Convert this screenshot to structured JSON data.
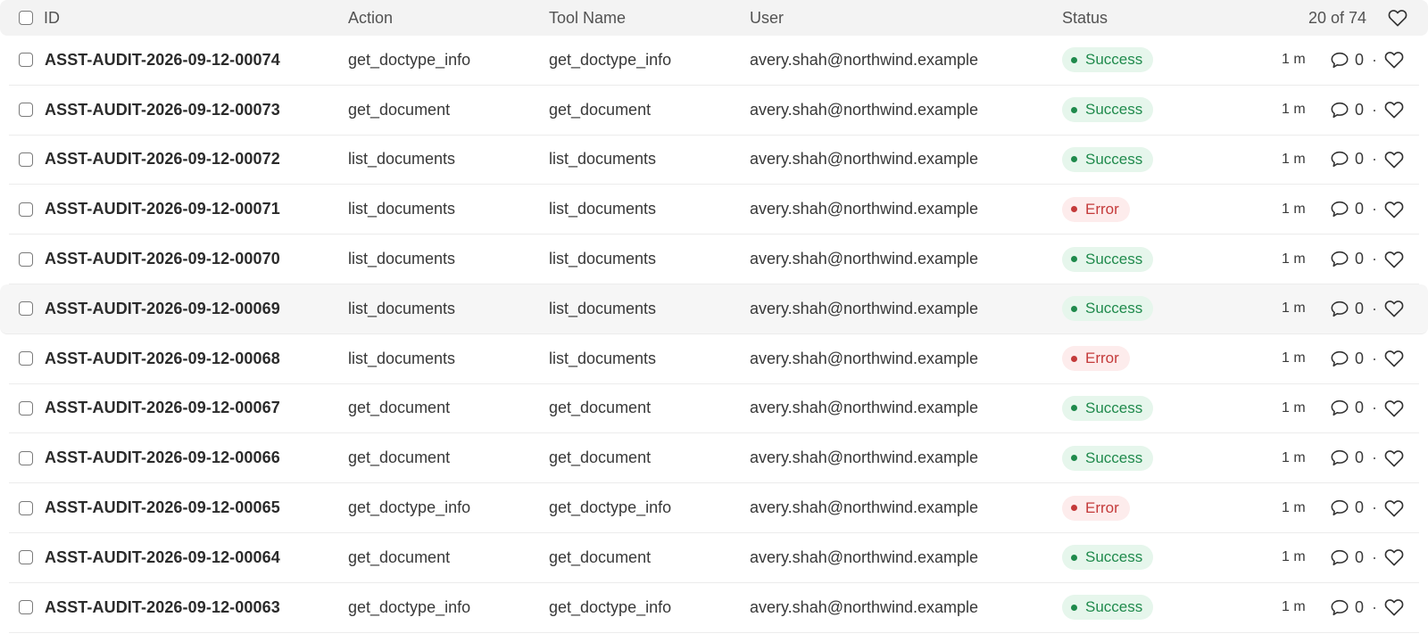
{
  "header": {
    "id_label": "ID",
    "action_label": "Action",
    "tool_label": "Tool Name",
    "user_label": "User",
    "status_label": "Status",
    "count_label": "20 of 74"
  },
  "icons": {
    "comment": "comment-icon",
    "like": "heart-icon",
    "checkbox": "checkbox"
  },
  "colors": {
    "success": "#1f8a4c",
    "success_bg": "#e6f6ec",
    "error": "#c43a3a",
    "error_bg": "#fdecec"
  },
  "rows": [
    {
      "id": "ASST-AUDIT-2026-09-12-00074",
      "action": "get_doctype_info",
      "tool": "get_doctype_info",
      "user": "avery.shah@northwind.example",
      "status": "Success",
      "status_kind": "success",
      "time": "1 m",
      "comments": "0",
      "sep": "·"
    },
    {
      "id": "ASST-AUDIT-2026-09-12-00073",
      "action": "get_document",
      "tool": "get_document",
      "user": "avery.shah@northwind.example",
      "status": "Success",
      "status_kind": "success",
      "time": "1 m",
      "comments": "0",
      "sep": "·"
    },
    {
      "id": "ASST-AUDIT-2026-09-12-00072",
      "action": "list_documents",
      "tool": "list_documents",
      "user": "avery.shah@northwind.example",
      "status": "Success",
      "status_kind": "success",
      "time": "1 m",
      "comments": "0",
      "sep": "·"
    },
    {
      "id": "ASST-AUDIT-2026-09-12-00071",
      "action": "list_documents",
      "tool": "list_documents",
      "user": "avery.shah@northwind.example",
      "status": "Error",
      "status_kind": "error",
      "time": "1 m",
      "comments": "0",
      "sep": "·"
    },
    {
      "id": "ASST-AUDIT-2026-09-12-00070",
      "action": "list_documents",
      "tool": "list_documents",
      "user": "avery.shah@northwind.example",
      "status": "Success",
      "status_kind": "success",
      "time": "1 m",
      "comments": "0",
      "sep": "·"
    },
    {
      "id": "ASST-AUDIT-2026-09-12-00069",
      "action": "list_documents",
      "tool": "list_documents",
      "user": "avery.shah@northwind.example",
      "status": "Success",
      "status_kind": "success",
      "time": "1 m",
      "comments": "0",
      "sep": "·",
      "hovered": true
    },
    {
      "id": "ASST-AUDIT-2026-09-12-00068",
      "action": "list_documents",
      "tool": "list_documents",
      "user": "avery.shah@northwind.example",
      "status": "Error",
      "status_kind": "error",
      "time": "1 m",
      "comments": "0",
      "sep": "·"
    },
    {
      "id": "ASST-AUDIT-2026-09-12-00067",
      "action": "get_document",
      "tool": "get_document",
      "user": "avery.shah@northwind.example",
      "status": "Success",
      "status_kind": "success",
      "time": "1 m",
      "comments": "0",
      "sep": "·"
    },
    {
      "id": "ASST-AUDIT-2026-09-12-00066",
      "action": "get_document",
      "tool": "get_document",
      "user": "avery.shah@northwind.example",
      "status": "Success",
      "status_kind": "success",
      "time": "1 m",
      "comments": "0",
      "sep": "·"
    },
    {
      "id": "ASST-AUDIT-2026-09-12-00065",
      "action": "get_doctype_info",
      "tool": "get_doctype_info",
      "user": "avery.shah@northwind.example",
      "status": "Error",
      "status_kind": "error",
      "time": "1 m",
      "comments": "0",
      "sep": "·"
    },
    {
      "id": "ASST-AUDIT-2026-09-12-00064",
      "action": "get_document",
      "tool": "get_document",
      "user": "avery.shah@northwind.example",
      "status": "Success",
      "status_kind": "success",
      "time": "1 m",
      "comments": "0",
      "sep": "·"
    },
    {
      "id": "ASST-AUDIT-2026-09-12-00063",
      "action": "get_doctype_info",
      "tool": "get_doctype_info",
      "user": "avery.shah@northwind.example",
      "status": "Success",
      "status_kind": "success",
      "time": "1 m",
      "comments": "0",
      "sep": "·"
    }
  ]
}
